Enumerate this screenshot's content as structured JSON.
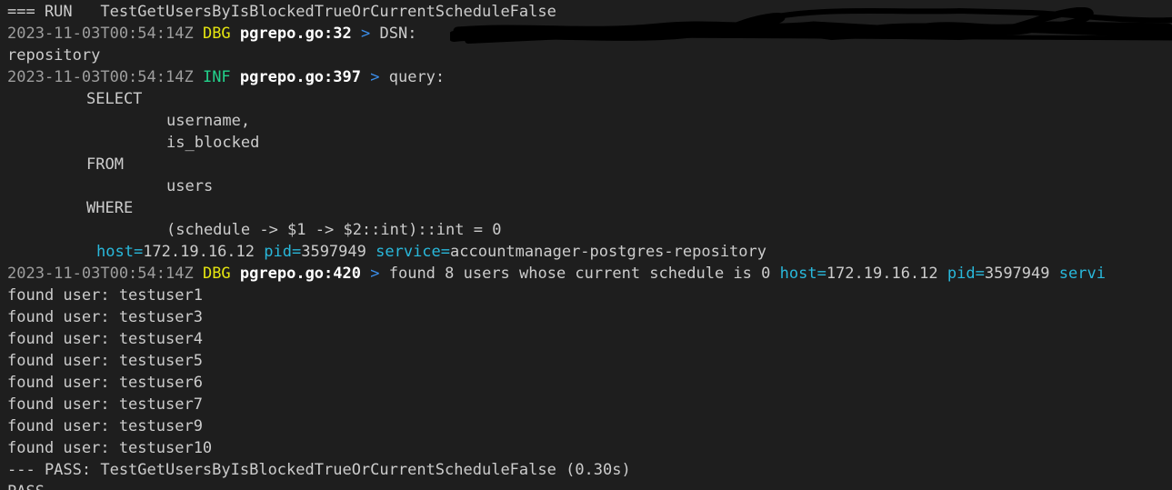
{
  "run_line": "=== RUN   TestGetUsersByIsBlockedTrueOrCurrentScheduleFalse",
  "log1": {
    "ts": "2023-11-03T00:54:14Z",
    "level": "DBG",
    "src": "pgrepo.go:32",
    "arrow": ">",
    "msg": "DSN:"
  },
  "line_repository": "repository",
  "log2": {
    "ts": "2023-11-03T00:54:14Z",
    "level": "INF",
    "src": "pgrepo.go:397",
    "arrow": ">",
    "msg": "query:"
  },
  "sql": {
    "select": "SELECT",
    "col1": "username,",
    "col2": "is_blocked",
    "from": "FROM",
    "table": "users",
    "where": "WHERE",
    "cond": "(schedule -> $1 -> $2::int)::int = 0"
  },
  "fields1": {
    "host_key": "host=",
    "host_val": "172.19.16.12",
    "pid_key": "pid=",
    "pid_val": "3597949",
    "service_key": "service=",
    "service_val": "accountmanager-postgres-repository"
  },
  "log3": {
    "ts": "2023-11-03T00:54:14Z",
    "level": "DBG",
    "src": "pgrepo.go:420",
    "arrow": ">",
    "msg": "found 8 users whose current schedule is 0",
    "host_key": "host=",
    "host_val": "172.19.16.12",
    "pid_key": "pid=",
    "pid_val": "3597949",
    "service_key": "servi"
  },
  "found_users": [
    "found user: testuser1",
    "found user: testuser3",
    "found user: testuser4",
    "found user: testuser5",
    "found user: testuser6",
    "found user: testuser7",
    "found user: testuser9",
    "found user: testuser10"
  ],
  "pass_line": "--- PASS: TestGetUsersByIsBlockedTrueOrCurrentScheduleFalse (0.30s)",
  "final_line": "PASS"
}
